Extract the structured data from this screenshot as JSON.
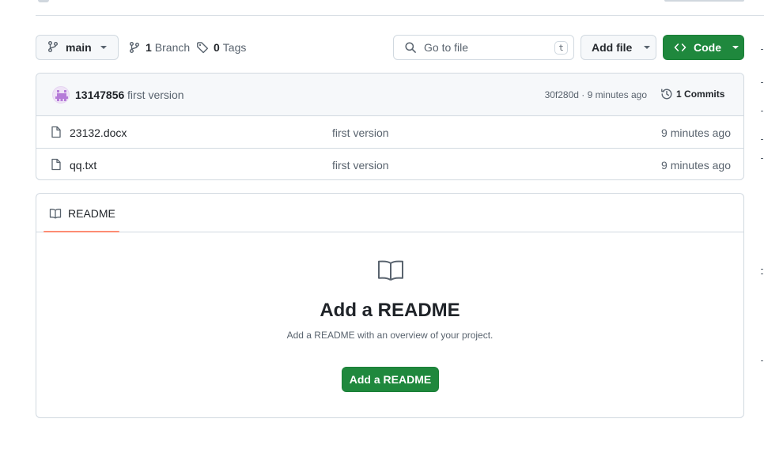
{
  "toolbar": {
    "branch_name": "main",
    "branch_count": "1",
    "branch_label": "Branch",
    "tag_count": "0",
    "tag_label": "Tags",
    "search_placeholder": "Go to file",
    "search_shortcut": "t",
    "add_file_label": "Add file",
    "code_label": "Code"
  },
  "commit": {
    "author": "13147856",
    "message": "first version",
    "hash_and_time": "30f280d · 9 minutes ago",
    "commits_count": "1",
    "commits_label": "Commits"
  },
  "files": [
    {
      "name": "23132.docx",
      "commit_message": "first version",
      "time": "9 minutes ago"
    },
    {
      "name": "qq.txt",
      "commit_message": "first version",
      "time": "9 minutes ago"
    }
  ],
  "readme": {
    "tab_label": "README",
    "heading": "Add a README",
    "subtext": "Add a README with an overview of your project.",
    "button_label": "Add a README"
  },
  "icons": {
    "branch": "git-branch-icon",
    "tag": "tag-icon",
    "search": "search-icon",
    "code": "code-icon",
    "history": "history-icon",
    "file": "file-icon",
    "book": "book-icon"
  },
  "colors": {
    "primary_green": "#1f883d",
    "tab_underline": "#fd8c73",
    "muted_text": "#59636e",
    "border": "#d1d9e0"
  }
}
